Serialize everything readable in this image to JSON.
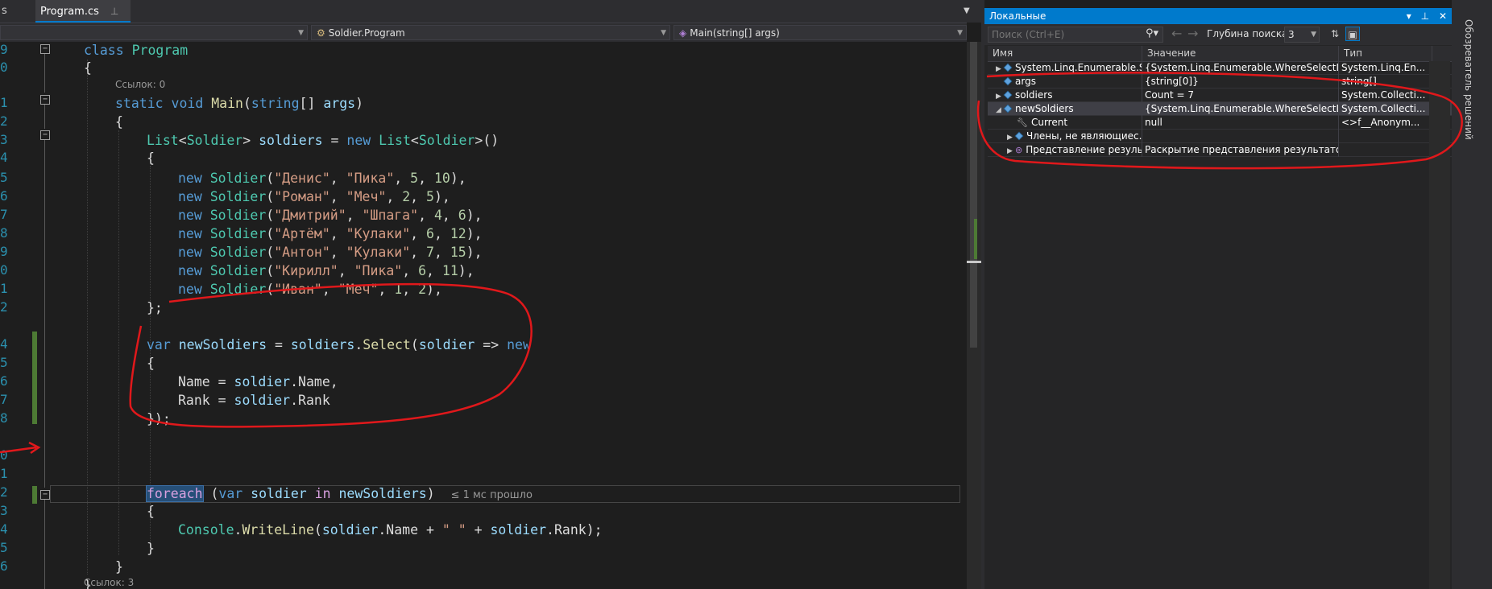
{
  "tabs": {
    "left_fragment": "s",
    "active": {
      "label": "Program.cs",
      "pin": "⊥",
      "close": "✕"
    }
  },
  "navbar": {
    "project": "",
    "class": "Soldier.Program",
    "member": "Main(string[] args)"
  },
  "editor": {
    "line_numbers": [
      "9",
      "0",
      "",
      "1",
      "2",
      "3",
      "4",
      "5",
      "6",
      "7",
      "8",
      "9",
      "0",
      "1",
      "2",
      "",
      "4",
      "5",
      "6",
      "7",
      "8",
      "",
      "0",
      "1",
      "2",
      "3",
      "4",
      "5",
      "6"
    ],
    "refs_top": "Ссылок: 0",
    "refs_bottom": "Ссылок: 3",
    "elapsed": "≤ 1 мс прошло",
    "soldiers": [
      {
        "name": "\"Денис\"",
        "weapon": "\"Пика\"",
        "a": "5",
        "b": "10"
      },
      {
        "name": "\"Роман\"",
        "weapon": "\"Меч\"",
        "a": "2",
        "b": "5"
      },
      {
        "name": "\"Дмитрий\"",
        "weapon": "\"Шпага\"",
        "a": "4",
        "b": "6"
      },
      {
        "name": "\"Артём\"",
        "weapon": "\"Кулаки\"",
        "a": "6",
        "b": "12"
      },
      {
        "name": "\"Антон\"",
        "weapon": "\"Кулаки\"",
        "a": "7",
        "b": "15"
      },
      {
        "name": "\"Кирилл\"",
        "weapon": "\"Пика\"",
        "a": "6",
        "b": "11"
      },
      {
        "name": "\"Иван\"",
        "weapon": "\"Меч\"",
        "a": "1",
        "b": "2"
      }
    ]
  },
  "locals": {
    "title": "Локальные",
    "search_placeholder": "Поиск (Ctrl+E)",
    "depth_label": "Глубина поиска:",
    "depth_value": "3",
    "columns": {
      "name": "Имя",
      "value": "Значение",
      "type": "Тип"
    },
    "rows": [
      {
        "name": "System.Linq.Enumerable.S...",
        "value": "{System.Linq.Enumerable.WhereSelectListIterator<S...",
        "type": "System.Linq.En..."
      },
      {
        "name": "args",
        "value": "{string[0]}",
        "type": "string[]"
      },
      {
        "name": "soldiers",
        "value": "Count = 7",
        "type": "System.Collecti..."
      },
      {
        "name": "newSoldiers",
        "value": "{System.Linq.Enumerable.WhereSelectListIterator<S...",
        "type": "System.Collecti..."
      },
      {
        "name": "Current",
        "value": "null",
        "type": "<>f__Anonym..."
      },
      {
        "name": "Члены, не являющиес...",
        "value": "",
        "type": ""
      },
      {
        "name": "Представление резуль...",
        "value": "Раскрытие представления результатов вызовет п...",
        "type": ""
      }
    ]
  },
  "side_tab": {
    "label": "Обозреватель решений"
  },
  "colors": {
    "accent": "#007acc",
    "annotation": "#e0181b",
    "keyword": "#569cd6",
    "type": "#4ec9b0",
    "string": "#d69d85"
  }
}
